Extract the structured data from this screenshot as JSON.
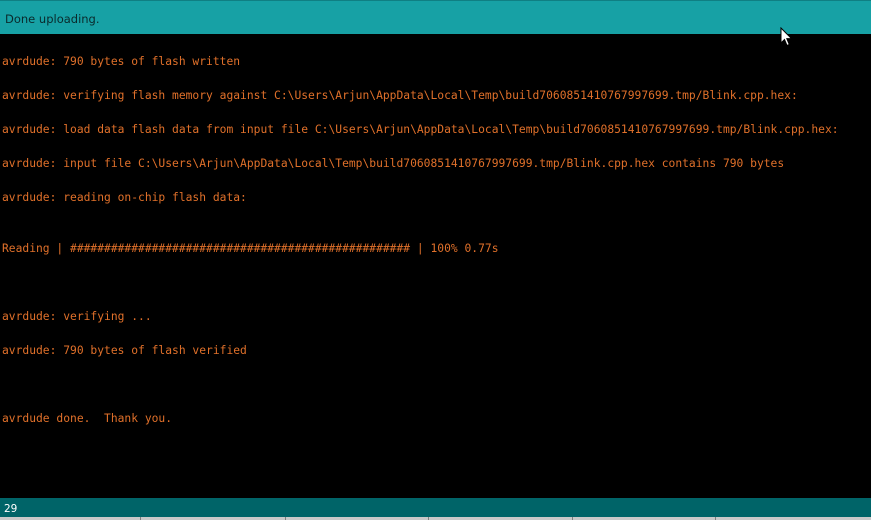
{
  "status": {
    "message": "Done uploading."
  },
  "console": {
    "lines": [
      "avrdude: 790 bytes of flash written",
      "avrdude: verifying flash memory against C:\\Users\\Arjun\\AppData\\Local\\Temp\\build7060851410767997699.tmp/Blink.cpp.hex:",
      "avrdude: load data flash data from input file C:\\Users\\Arjun\\AppData\\Local\\Temp\\build7060851410767997699.tmp/Blink.cpp.hex:",
      "avrdude: input file C:\\Users\\Arjun\\AppData\\Local\\Temp\\build7060851410767997699.tmp/Blink.cpp.hex contains 790 bytes",
      "avrdude: reading on-chip flash data:",
      "Reading | ################################################## | 100% 0.77s",
      "avrdude: verifying ...",
      "avrdude: 790 bytes of flash verified",
      "avrdude done.  Thank you."
    ]
  },
  "footer": {
    "line_number": "29"
  },
  "colors": {
    "status_bar": "#17a1a5",
    "console_bg": "#000000",
    "console_text": "#e0702a",
    "footer_bar": "#006468"
  },
  "icons": {
    "cursor": "mouse-pointer-icon"
  }
}
